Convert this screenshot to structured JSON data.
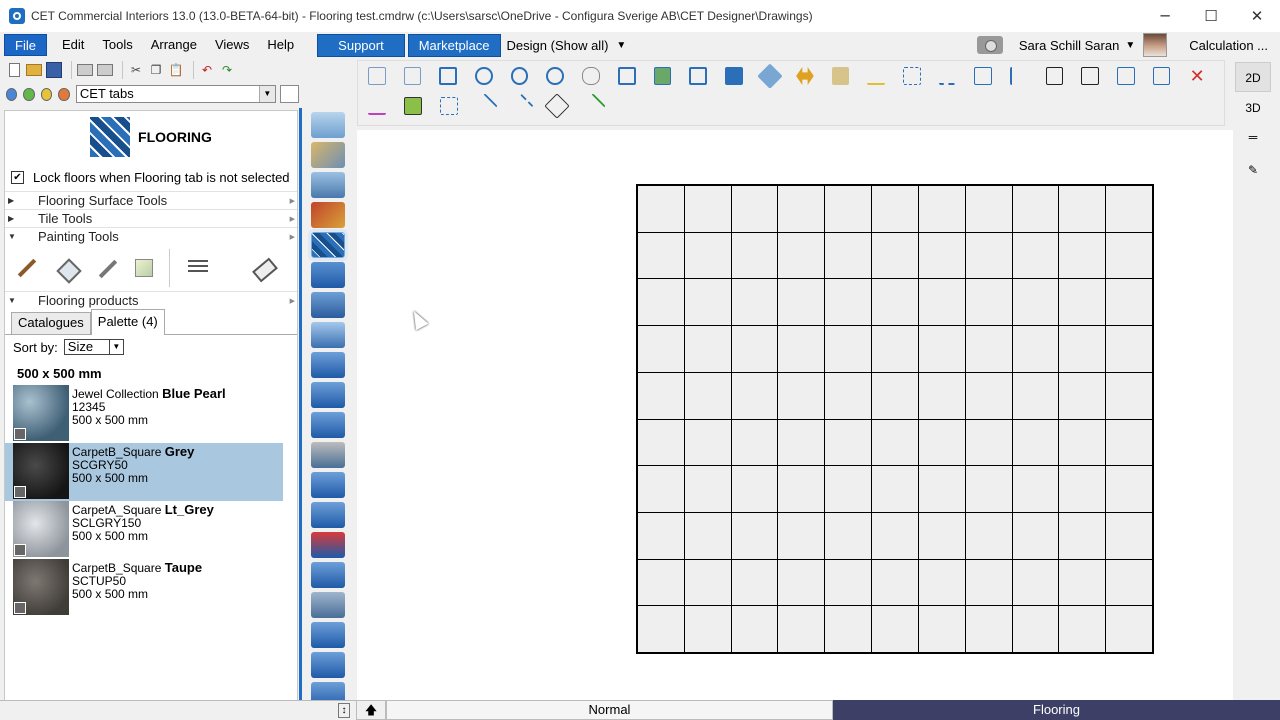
{
  "window": {
    "title": "CET Commercial Interiors 13.0 (13.0-BETA-64-bit) - Flooring test.cmdrw (c:\\Users\\sarsc\\OneDrive - Configura Sverige AB\\CET Designer\\Drawings)"
  },
  "menubar": {
    "items": [
      "File",
      "Edit",
      "Tools",
      "Arrange",
      "Views",
      "Help"
    ],
    "support": "Support",
    "marketplace": "Marketplace",
    "design": "Design (Show all)",
    "user": "Sara Schill Saran",
    "calculation": "Calculation ..."
  },
  "left": {
    "tabs_select": "CET tabs",
    "flooring_title": "FLOORING",
    "lock_label": "Lock floors when Flooring tab is not selected",
    "lock_checked": "✔",
    "sections": [
      "Flooring Surface Tools",
      "Tile Tools",
      "Painting Tools"
    ],
    "products_section": "Flooring products",
    "product_tabs": [
      "Catalogues",
      "Palette (4)"
    ],
    "sort_label": "Sort by:",
    "sort_value": "Size",
    "size_heading": "500 x 500 mm",
    "products": [
      {
        "collection": "Jewel Collection",
        "name": "Blue Pearl",
        "code": "12345",
        "size": "500 x 500 mm",
        "color": "#5b7a8e"
      },
      {
        "collection": "CarpetB_Square",
        "name": "Grey",
        "code": "SCGRY50",
        "size": "500 x 500 mm",
        "color": "#2a2a2a"
      },
      {
        "collection": "CarpetA_Square",
        "name": "Lt_Grey",
        "code": "SCLGRY150",
        "size": "500 x 500 mm",
        "color": "#9fa3a8"
      },
      {
        "collection": "CarpetB_Square",
        "name": "Taupe",
        "code": "SCTUP50",
        "size": "500 x 500 mm",
        "color": "#5e5a55"
      }
    ]
  },
  "view": {
    "btn_2d": "2D",
    "btn_3d": "3D"
  },
  "status": {
    "mode": "Normal",
    "tab": "Flooring"
  },
  "colors": {
    "accent": "#1f6ec4",
    "selection": "#a9c8e0",
    "status_active": "#3d3f66"
  }
}
